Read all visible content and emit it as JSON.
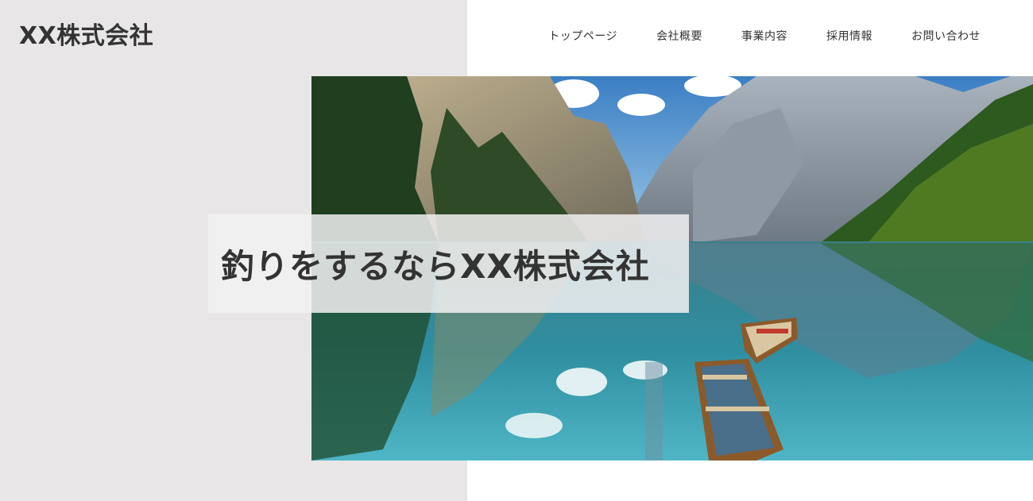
{
  "header": {
    "logo_text": "XX株式会社",
    "nav": [
      {
        "label": "トップページ"
      },
      {
        "label": "会社概要"
      },
      {
        "label": "事業内容"
      },
      {
        "label": "採用情報"
      },
      {
        "label": "お問い合わせ"
      }
    ]
  },
  "hero": {
    "catch_copy": "釣りをするならXX株式会社"
  },
  "colors": {
    "left_panel": "#e8e6e7",
    "text": "#333333",
    "background": "#ffffff"
  }
}
